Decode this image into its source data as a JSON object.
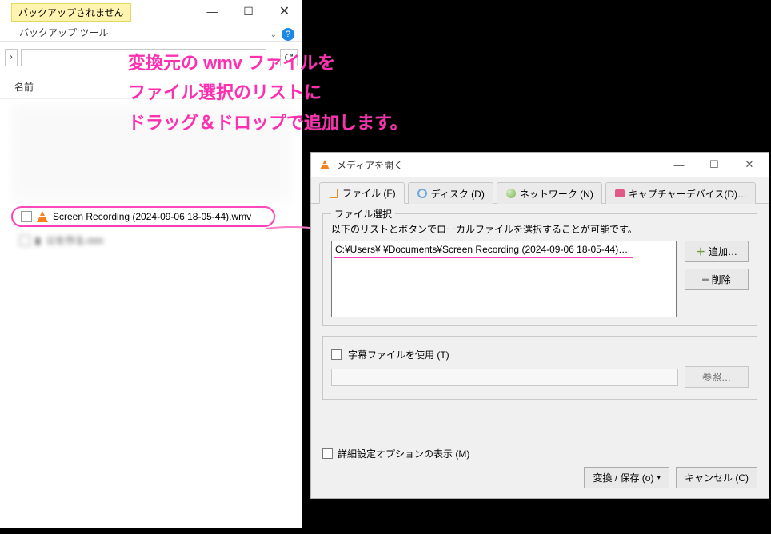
{
  "explorer": {
    "ribbon_hint": "バックアップされません",
    "ribbon_tab": "バックアップ ツール",
    "addr_right_label": "›",
    "column_header": "名前",
    "selected_file": "Screen Recording (2024-09-06 18-05-44).wmv",
    "below_file": "公を作る.mm"
  },
  "annotation": {
    "line1": "変換元の wmv ファイルを",
    "line2": "ファイル選択のリストに",
    "line3": "ドラッグ＆ドロップで追加します。"
  },
  "vlc": {
    "title": "メディアを開く",
    "tabs": {
      "file": "ファイル (F)",
      "disc": "ディスク (D)",
      "network": "ネットワーク (N)",
      "capture": "キャプチャーデバイス(D)…"
    },
    "group_title": "ファイル選択",
    "file_hint": "以下のリストとボタンでローカルファイルを選択することが可能です。",
    "file_entry": "C:¥Users¥          ¥Documents¥Screen Recording (2024-09-06 18-05-44)…",
    "add_btn": "追加…",
    "remove_btn": "削除",
    "subtitle_check": "字幕ファイルを使用 (T)",
    "browse_btn": "参照…",
    "advanced_check": "詳細設定オプションの表示 (M)",
    "convert_btn": "変換 / 保存 (o)",
    "cancel_btn": "キャンセル (C)"
  }
}
